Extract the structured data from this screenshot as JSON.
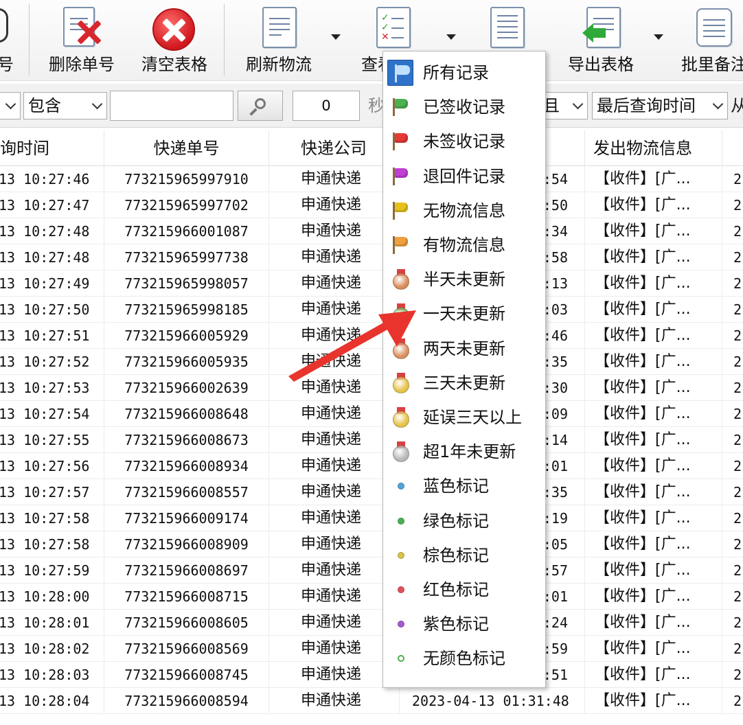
{
  "toolbar": {
    "left_partial_label": "号",
    "buttons": [
      {
        "label": "删除单号",
        "icon": "delete-number-icon"
      },
      {
        "label": "清空表格",
        "icon": "clear-table-icon"
      },
      {
        "label": "刷新物流",
        "icon": "refresh-logistics-icon"
      },
      {
        "label": "查看",
        "icon": "view-checklist-icon"
      },
      {
        "label": "",
        "icon": "columns-icon"
      },
      {
        "label": "导出表格",
        "icon": "export-table-icon"
      },
      {
        "label": "批里备注",
        "icon": "batch-note-icon"
      }
    ]
  },
  "filter": {
    "condition": "包含",
    "search_value": "",
    "seconds_value": "0",
    "seconds_label_partial": "秒",
    "logic_partial": "且",
    "time_field": "最后查询时间",
    "trailing_partial": "从"
  },
  "table": {
    "headers": [
      "询时间",
      "快递单号",
      "快递公司",
      "发出物流信息"
    ],
    "rows": [
      {
        "time": "13 10:27:46",
        "number": "773215965997910",
        "company": "申通快递",
        "last": ":54",
        "info": "【收件】[广...",
        "x": "2"
      },
      {
        "time": "13 10:27:47",
        "number": "773215965997702",
        "company": "申通快递",
        "last": ":50",
        "info": "【收件】[广...",
        "x": "2"
      },
      {
        "time": "13 10:27:48",
        "number": "773215966001087",
        "company": "申通快递",
        "last": ":34",
        "info": "【收件】[广...",
        "x": "2"
      },
      {
        "time": "13 10:27:48",
        "number": "773215965997738",
        "company": "申通快递",
        "last": ":58",
        "info": "【收件】[广...",
        "x": "2"
      },
      {
        "time": "13 10:27:49",
        "number": "773215965998057",
        "company": "申通快递",
        "last": ":13",
        "info": "【收件】[广...",
        "x": "2"
      },
      {
        "time": "13 10:27:50",
        "number": "773215965998185",
        "company": "申通快递",
        "last": ":03",
        "info": "【收件】[广...",
        "x": "2"
      },
      {
        "time": "13 10:27:51",
        "number": "773215966005929",
        "company": "申通快递",
        "last": ":46",
        "info": "【收件】[广...",
        "x": "2"
      },
      {
        "time": "13 10:27:52",
        "number": "773215966005935",
        "company": "申通快递",
        "last": ":35",
        "info": "【收件】[广...",
        "x": "2"
      },
      {
        "time": "13 10:27:53",
        "number": "773215966002639",
        "company": "申通快递",
        "last": ":30",
        "info": "【收件】[广...",
        "x": "2"
      },
      {
        "time": "13 10:27:54",
        "number": "773215966008648",
        "company": "申通快递",
        "last": ":09",
        "info": "【收件】[广...",
        "x": "2"
      },
      {
        "time": "13 10:27:55",
        "number": "773215966008673",
        "company": "申通快递",
        "last": ":14",
        "info": "【收件】[广...",
        "x": "2"
      },
      {
        "time": "13 10:27:56",
        "number": "773215966008934",
        "company": "申通快递",
        "last": ":01",
        "info": "【收件】[广...",
        "x": "2"
      },
      {
        "time": "13 10:27:57",
        "number": "773215966008557",
        "company": "申通快递",
        "last": ":35",
        "info": "【收件】[广...",
        "x": "2"
      },
      {
        "time": "13 10:27:58",
        "number": "773215966009174",
        "company": "申通快递",
        "last": ":19",
        "info": "【收件】[广...",
        "x": "2"
      },
      {
        "time": "13 10:27:58",
        "number": "773215966008909",
        "company": "申通快递",
        "last": ":05",
        "info": "【收件】[广...",
        "x": "2"
      },
      {
        "time": "13 10:27:59",
        "number": "773215966008697",
        "company": "申通快递",
        "last": ":57",
        "info": "【收件】[广...",
        "x": "2"
      },
      {
        "time": "13 10:28:00",
        "number": "773215966008715",
        "company": "申通快递",
        "last": ":01",
        "info": "【收件】[广...",
        "x": "2"
      },
      {
        "time": "13 10:28:01",
        "number": "773215966008605",
        "company": "申通快递",
        "last": ":24",
        "info": "【收件】[广...",
        "x": "2"
      },
      {
        "time": "13 10:28:02",
        "number": "773215966008569",
        "company": "申通快递",
        "last": ":59",
        "info": "【收件】[广...",
        "x": "2"
      },
      {
        "time": "13 10:28:03",
        "number": "773215966008745",
        "company": "申通快递",
        "last": ":51",
        "info": "【收件】[广...",
        "x": "2"
      },
      {
        "time": "13 10:28:04",
        "number": "773215966008594",
        "company": "申通快递",
        "last": "2023-04-13 01:31:48",
        "info": "【收件】[广...",
        "x": "2"
      }
    ]
  },
  "menu": {
    "items": [
      {
        "label": "所有记录",
        "icon": "all-records-flag-icon",
        "kind": "flag",
        "color": "#4a90d9",
        "selected": true
      },
      {
        "label": "已签收记录",
        "icon": "green-flag-icon",
        "kind": "flag",
        "color": "#4caf50"
      },
      {
        "label": "未签收记录",
        "icon": "red-flag-icon",
        "kind": "flag",
        "color": "#e53935"
      },
      {
        "label": "退回件记录",
        "icon": "purple-flag-icon",
        "kind": "flag",
        "color": "#c23fd6"
      },
      {
        "label": "无物流信息",
        "icon": "yellow-flag-icon",
        "kind": "flag",
        "color": "#e8c21c"
      },
      {
        "label": "有物流信息",
        "icon": "orange-flag-icon",
        "kind": "flag",
        "color": "#f0a040"
      },
      {
        "label": "半天未更新",
        "icon": "bronze-medal-icon",
        "kind": "medal",
        "color": "#d98c5a"
      },
      {
        "label": "一天未更新",
        "icon": "green-medal-icon",
        "kind": "medal",
        "color": "#6cbf5a"
      },
      {
        "label": "两天未更新",
        "icon": "blue-medal-icon",
        "kind": "medal",
        "color": "#d99060"
      },
      {
        "label": "三天未更新",
        "icon": "gold-medal-icon",
        "kind": "medal",
        "color": "#e6c24a"
      },
      {
        "label": "延误三天以上",
        "icon": "red-gold-medal-icon",
        "kind": "medal",
        "color": "#e6c24a"
      },
      {
        "label": "超1年未更新",
        "icon": "silver-medal-icon",
        "kind": "medal",
        "color": "#b8b8b8"
      },
      {
        "label": "蓝色标记",
        "icon": "blue-dot-icon",
        "kind": "dot",
        "color": "#4fa3d8"
      },
      {
        "label": "绿色标记",
        "icon": "green-dot-icon",
        "kind": "dot",
        "color": "#4caf50"
      },
      {
        "label": "棕色标记",
        "icon": "brown-dot-icon",
        "kind": "dot",
        "color": "#d9c24a"
      },
      {
        "label": "红色标记",
        "icon": "red-dot-icon",
        "kind": "dot",
        "color": "#e0505a"
      },
      {
        "label": "紫色标记",
        "icon": "purple-dot-icon",
        "kind": "dot",
        "color": "#a35ad0"
      },
      {
        "label": "无颜色标记",
        "icon": "no-color-dot-icon",
        "kind": "ring",
        "color": "#4caf50"
      }
    ]
  },
  "annotation": {
    "color": "#e8342c"
  }
}
